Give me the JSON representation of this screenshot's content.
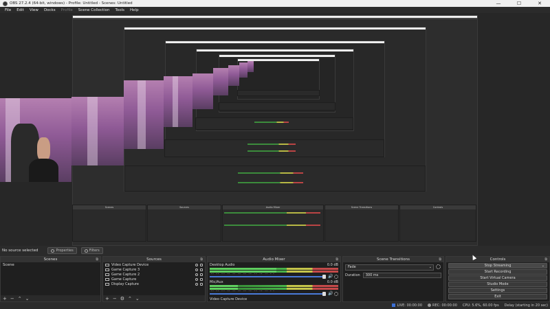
{
  "window": {
    "title": "OBS 27.2.4 (64-bit, windows) - Profile: Untitled - Scenes: Untitled",
    "minimize": "—",
    "maximize": "☐",
    "close": "✕"
  },
  "menu": [
    {
      "label": "File"
    },
    {
      "label": "Edit"
    },
    {
      "label": "View"
    },
    {
      "label": "Docks"
    },
    {
      "label": "Profile"
    },
    {
      "label": "Scene Collection"
    },
    {
      "label": "Tools"
    },
    {
      "label": "Help"
    }
  ],
  "preview_status": {
    "selection": "No source selected",
    "properties": "Properties",
    "filters": "Filters"
  },
  "scenes": {
    "title": "Scenes",
    "items": [
      "Scene"
    ]
  },
  "sources": {
    "title": "Sources",
    "items": [
      "Video Capture Device",
      "Game Capture 3",
      "Game Capture 2",
      "Game Capture",
      "Display Capture"
    ]
  },
  "mixer": {
    "title": "Audio Mixer",
    "channels": [
      {
        "name": "Desktop Audio",
        "level": "0.0 dB",
        "fill": 0.52
      },
      {
        "name": "Mic/Aux",
        "level": "0.0 dB",
        "fill": 0.22
      },
      {
        "name": "Video Capture Device",
        "level": "",
        "fill": 0.0
      }
    ],
    "ticks": "-60 -55 -50 -45 -40 -35 -30 -25 -20 -15 -10 -5 0"
  },
  "transitions": {
    "title": "Scene Transitions",
    "selected": "Fade",
    "duration_label": "Duration",
    "duration_value": "300 ms"
  },
  "controls": {
    "title": "Controls",
    "buttons": [
      {
        "label": "Stop Streaming",
        "active": true
      },
      {
        "label": "Start Recording"
      },
      {
        "label": "Start Virtual Camera"
      },
      {
        "label": "Studio Mode"
      },
      {
        "label": "Settings"
      },
      {
        "label": "Exit"
      }
    ]
  },
  "statusbar": {
    "live": "LIVE: 00:00:00",
    "rec": "REC: 00:00:00",
    "cpu": "CPU: 5.6%, 60.00 fps",
    "delay": "Delay (starting in 20 sec)"
  },
  "colors": {
    "accent": "#3b6fd4",
    "background": "#2b2b2b"
  }
}
